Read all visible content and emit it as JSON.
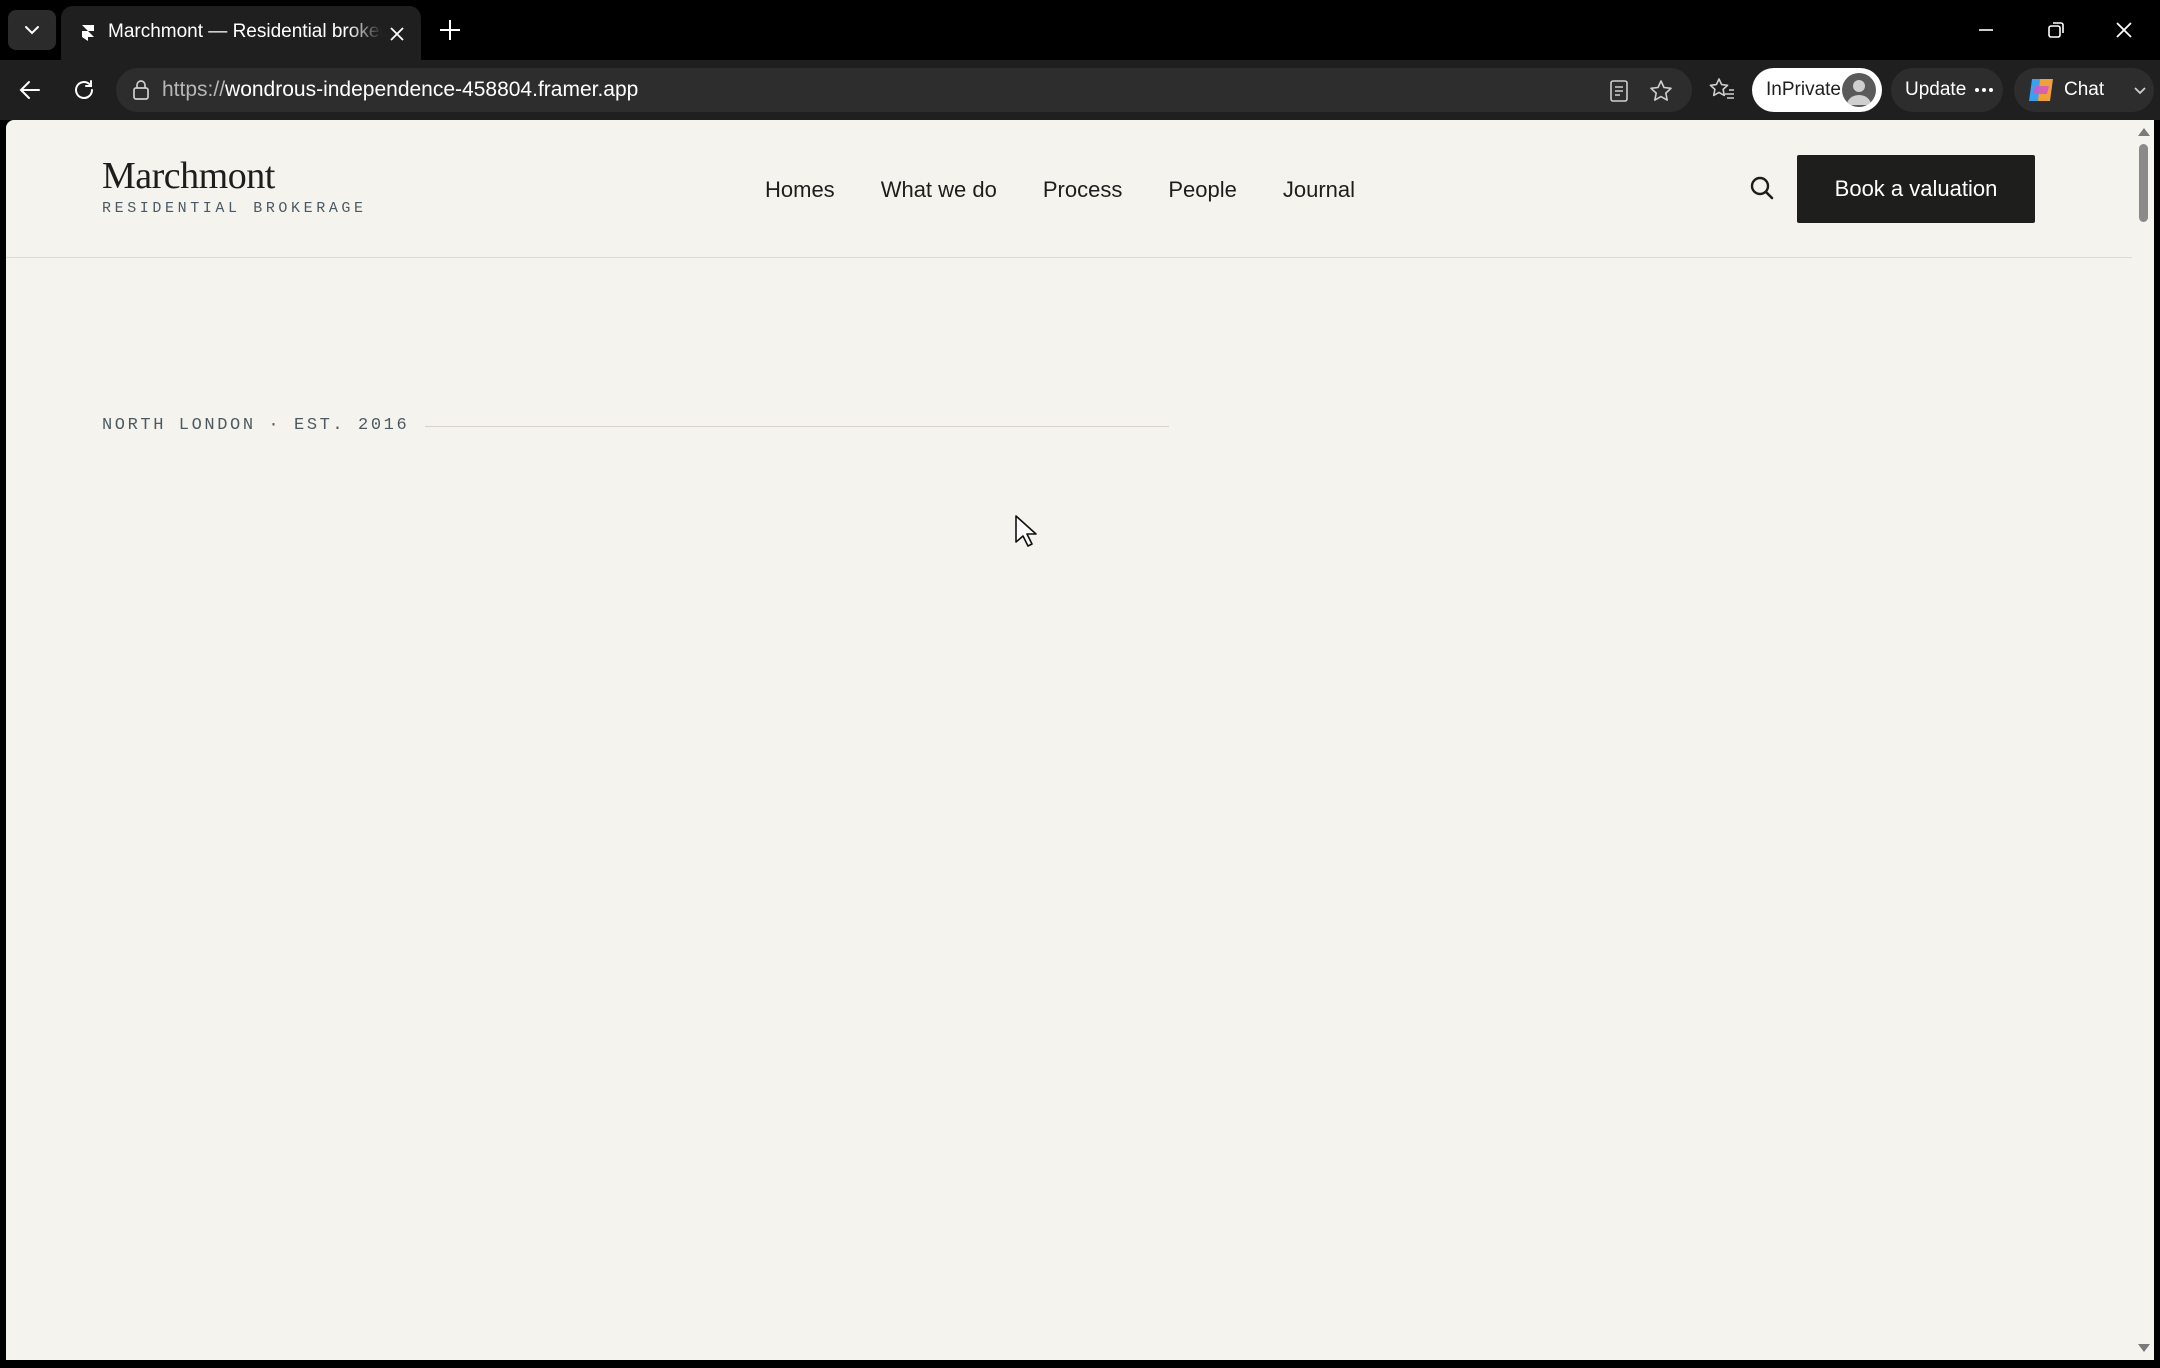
{
  "browser": {
    "tab_title": "Marchmont — Residential brokerage",
    "url_prefix": "https://",
    "url_host": "wondrous-independence-458804.framer.app",
    "inprivate_label": "InPrivate",
    "update_label": "Update",
    "chat_label": "Chat"
  },
  "site": {
    "logo_name": "Marchmont",
    "logo_tagline": "RESIDENTIAL BROKERAGE",
    "nav": [
      "Homes",
      "What we do",
      "Process",
      "People",
      "Journal"
    ],
    "cta_label": "Book a valuation",
    "eyebrow": "NORTH LONDON · EST. 2016"
  },
  "colors": {
    "page_background": "#f5f3ee",
    "ink": "#1d1e1c",
    "cta_background": "#1e1f1c",
    "muted_mono": "#4d5a62"
  }
}
